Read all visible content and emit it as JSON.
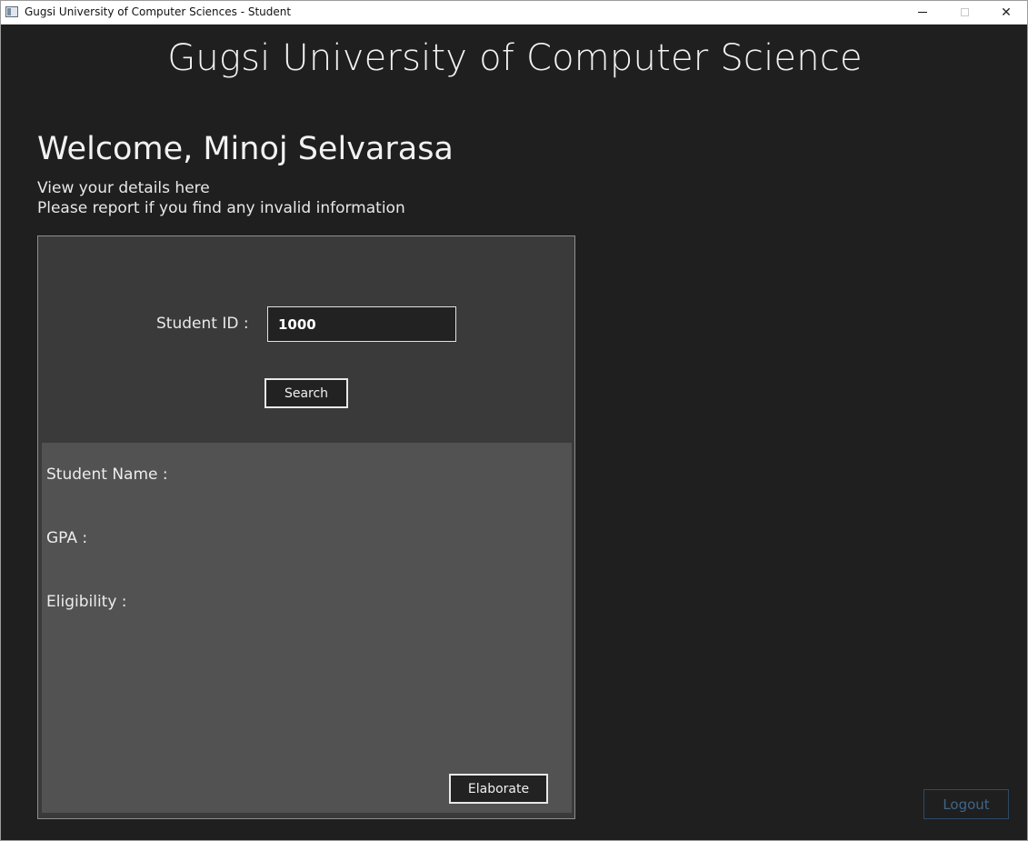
{
  "window": {
    "title": "Gugsi University of Computer Sciences - Student",
    "icon": "app-window-icon",
    "controls": {
      "minimize_icon": "minimize-icon",
      "maximize_icon": "maximize-icon",
      "close_icon": "close-icon",
      "close_glyph": "✕"
    }
  },
  "header": {
    "title": "Gugsi University of Computer Science"
  },
  "welcome": {
    "heading": "Welcome, Minoj Selvarasa",
    "line1": "View your details here",
    "line2": "Please report if you find any invalid information"
  },
  "search": {
    "label": "Student ID :",
    "value": "1000",
    "button_label": "Search"
  },
  "details": {
    "name_label": "Student Name :",
    "gpa_label": "GPA :",
    "eligibility_label": "Eligibility :",
    "elaborate_label": "Elaborate"
  },
  "footer": {
    "logout_label": "Logout",
    "logout_state": "disabled"
  },
  "colors": {
    "background": "#1f1f1f",
    "panel": "#3a3a3a",
    "details_panel": "#525252",
    "text": "#f2f2f2",
    "logout_disabled": "#3f6688"
  }
}
